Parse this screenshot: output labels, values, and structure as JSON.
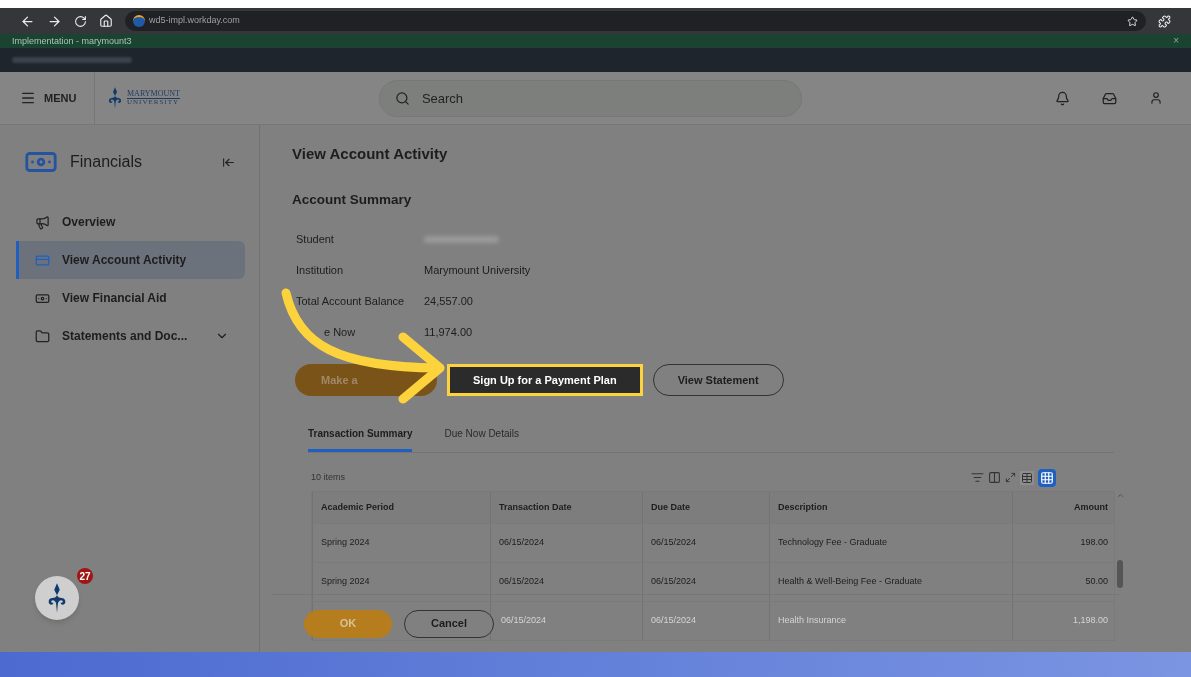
{
  "browser": {
    "url": "wd5-impl.workday.com"
  },
  "banner": {
    "title": "Implementation - marymount3",
    "close": "×"
  },
  "header": {
    "menu": "MENU",
    "logo_name": "MARYMOUNT",
    "logo_sub": "UNIVERSITY",
    "search": {
      "placeholder": "Search"
    }
  },
  "sidebar": {
    "title": "Financials",
    "items": [
      {
        "label": "Overview",
        "selected": false
      },
      {
        "label": "View Account Activity",
        "selected": true
      },
      {
        "label": "View Financial Aid",
        "selected": false
      },
      {
        "label": "Statements and Doc...",
        "selected": false,
        "expandable": true
      }
    ],
    "assistant_badge": "27"
  },
  "page": {
    "title": "View Account Activity",
    "section": "Account Summary",
    "fields": [
      {
        "label": "Student",
        "blurred": true
      },
      {
        "label": "Institution",
        "value": "Marymount University"
      },
      {
        "label": "Total Account Balance",
        "value": "24,557.00"
      },
      {
        "label": "e Now",
        "value": "11,974.00"
      }
    ],
    "buttons": [
      {
        "label": "Make a",
        "kind": "primary"
      },
      {
        "label": "Sign Up for a Payment Plan",
        "kind": "dark",
        "highlighted": true
      },
      {
        "label": "View Statement",
        "kind": "outline"
      }
    ],
    "tabs": [
      {
        "label": "Transaction Summary",
        "selected": true
      },
      {
        "label": "Due Now Details",
        "selected": false
      }
    ],
    "table": {
      "count": "10 items",
      "columns": [
        "Academic Period",
        "Transaction Date",
        "Due Date",
        "Description",
        "Amount"
      ],
      "rows": [
        {
          "cells": [
            "Spring 2024",
            "06/15/2024",
            "06/15/2024",
            "Technology Fee - Graduate",
            "198.00"
          ],
          "faded": false
        },
        {
          "cells": [
            "Spring 2024",
            "06/15/2024",
            "06/15/2024",
            "Health & Well-Being Fee - Graduate",
            "50.00"
          ],
          "faded": false
        },
        {
          "cells": [
            "",
            "06/15/2024",
            "06/15/2024",
            "Health Insurance",
            "1,198.00"
          ],
          "faded": true
        }
      ]
    },
    "footer": {
      "ok": "OK",
      "cancel": "Cancel"
    }
  }
}
